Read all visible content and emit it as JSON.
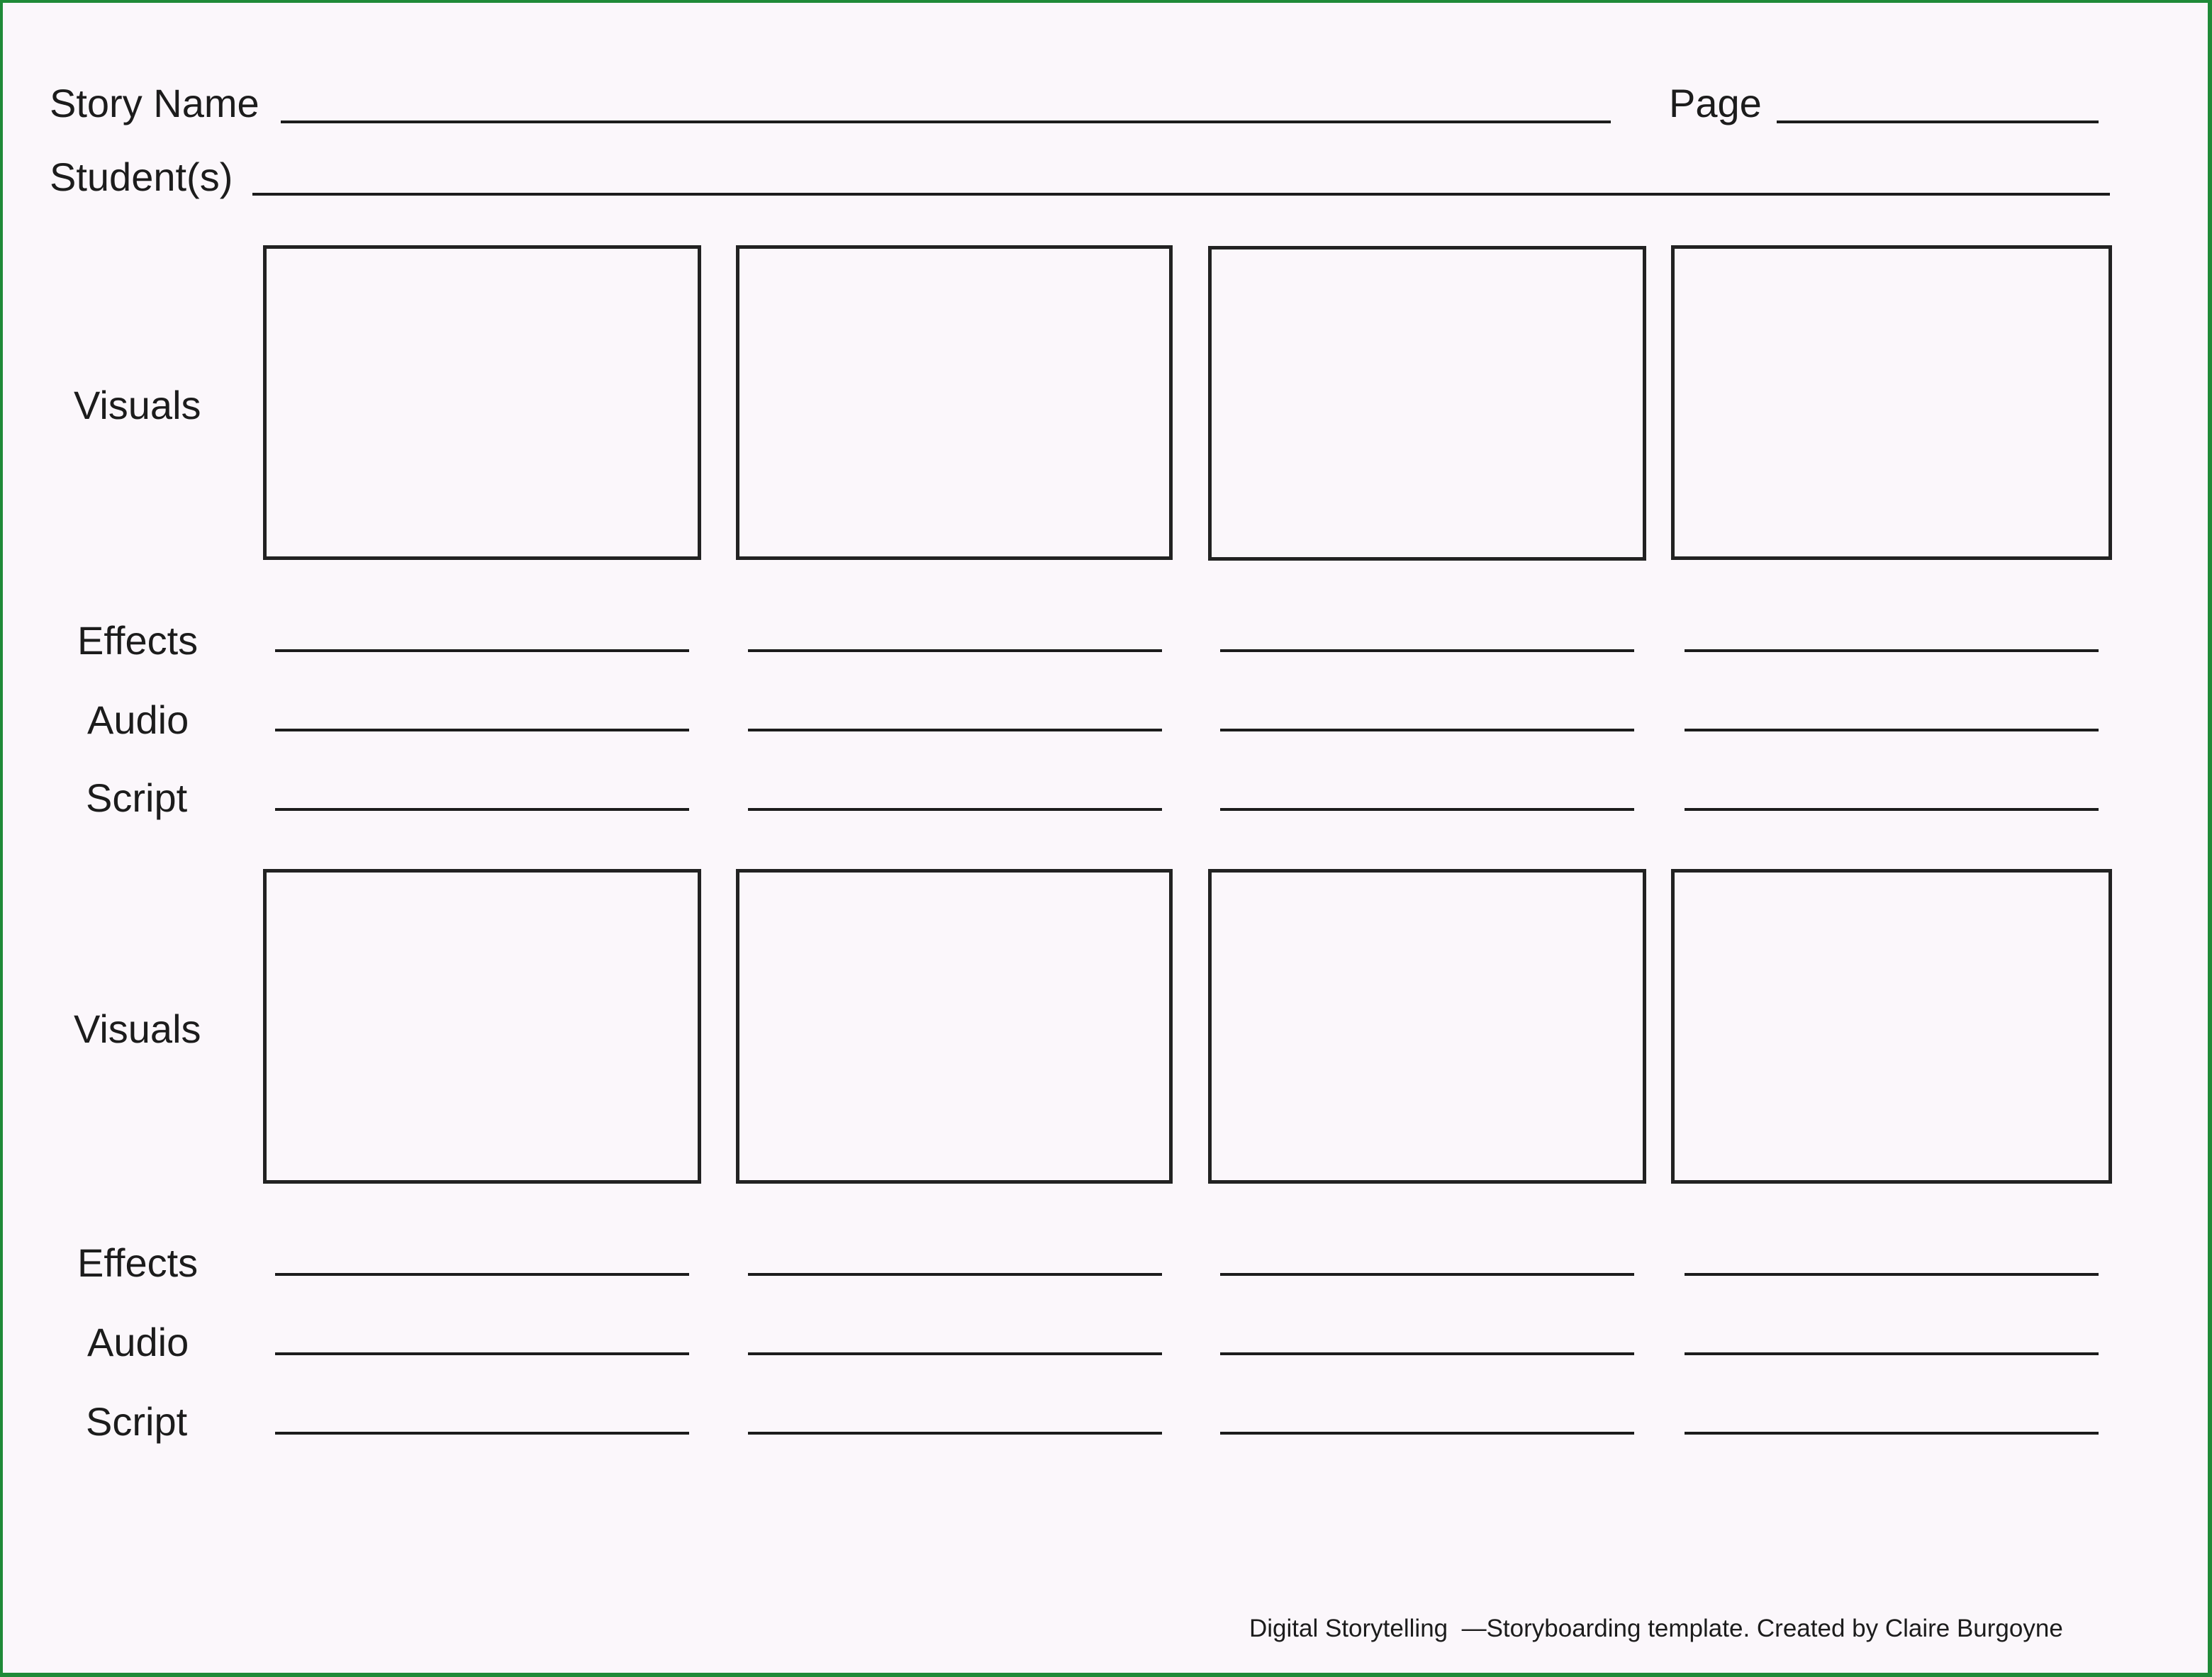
{
  "header": {
    "story_name_label": "Story Name",
    "page_label": "Page",
    "students_label": "Student(s)",
    "story_name_value": "",
    "page_value": "",
    "students_value": ""
  },
  "sections": [
    {
      "visuals_label": "Visuals",
      "rows": [
        {
          "label": "Effects",
          "values": [
            "",
            "",
            "",
            ""
          ]
        },
        {
          "label": "Audio",
          "values": [
            "",
            "",
            "",
            ""
          ]
        },
        {
          "label": "Script",
          "values": [
            "",
            "",
            "",
            ""
          ]
        }
      ],
      "panel_count": 4
    },
    {
      "visuals_label": "Visuals",
      "rows": [
        {
          "label": "Effects",
          "values": [
            "",
            "",
            "",
            ""
          ]
        },
        {
          "label": "Audio",
          "values": [
            "",
            "",
            "",
            ""
          ]
        },
        {
          "label": "Script",
          "values": [
            "",
            "",
            "",
            ""
          ]
        }
      ],
      "panel_count": 4
    }
  ],
  "footer": {
    "text": "Digital Storytelling  —Storyboarding template. Created by Claire Burgoyne"
  },
  "colors": {
    "page_background": "#fbf7fb",
    "border_green": "#1f8a38",
    "ink": "#1c1c1c"
  }
}
